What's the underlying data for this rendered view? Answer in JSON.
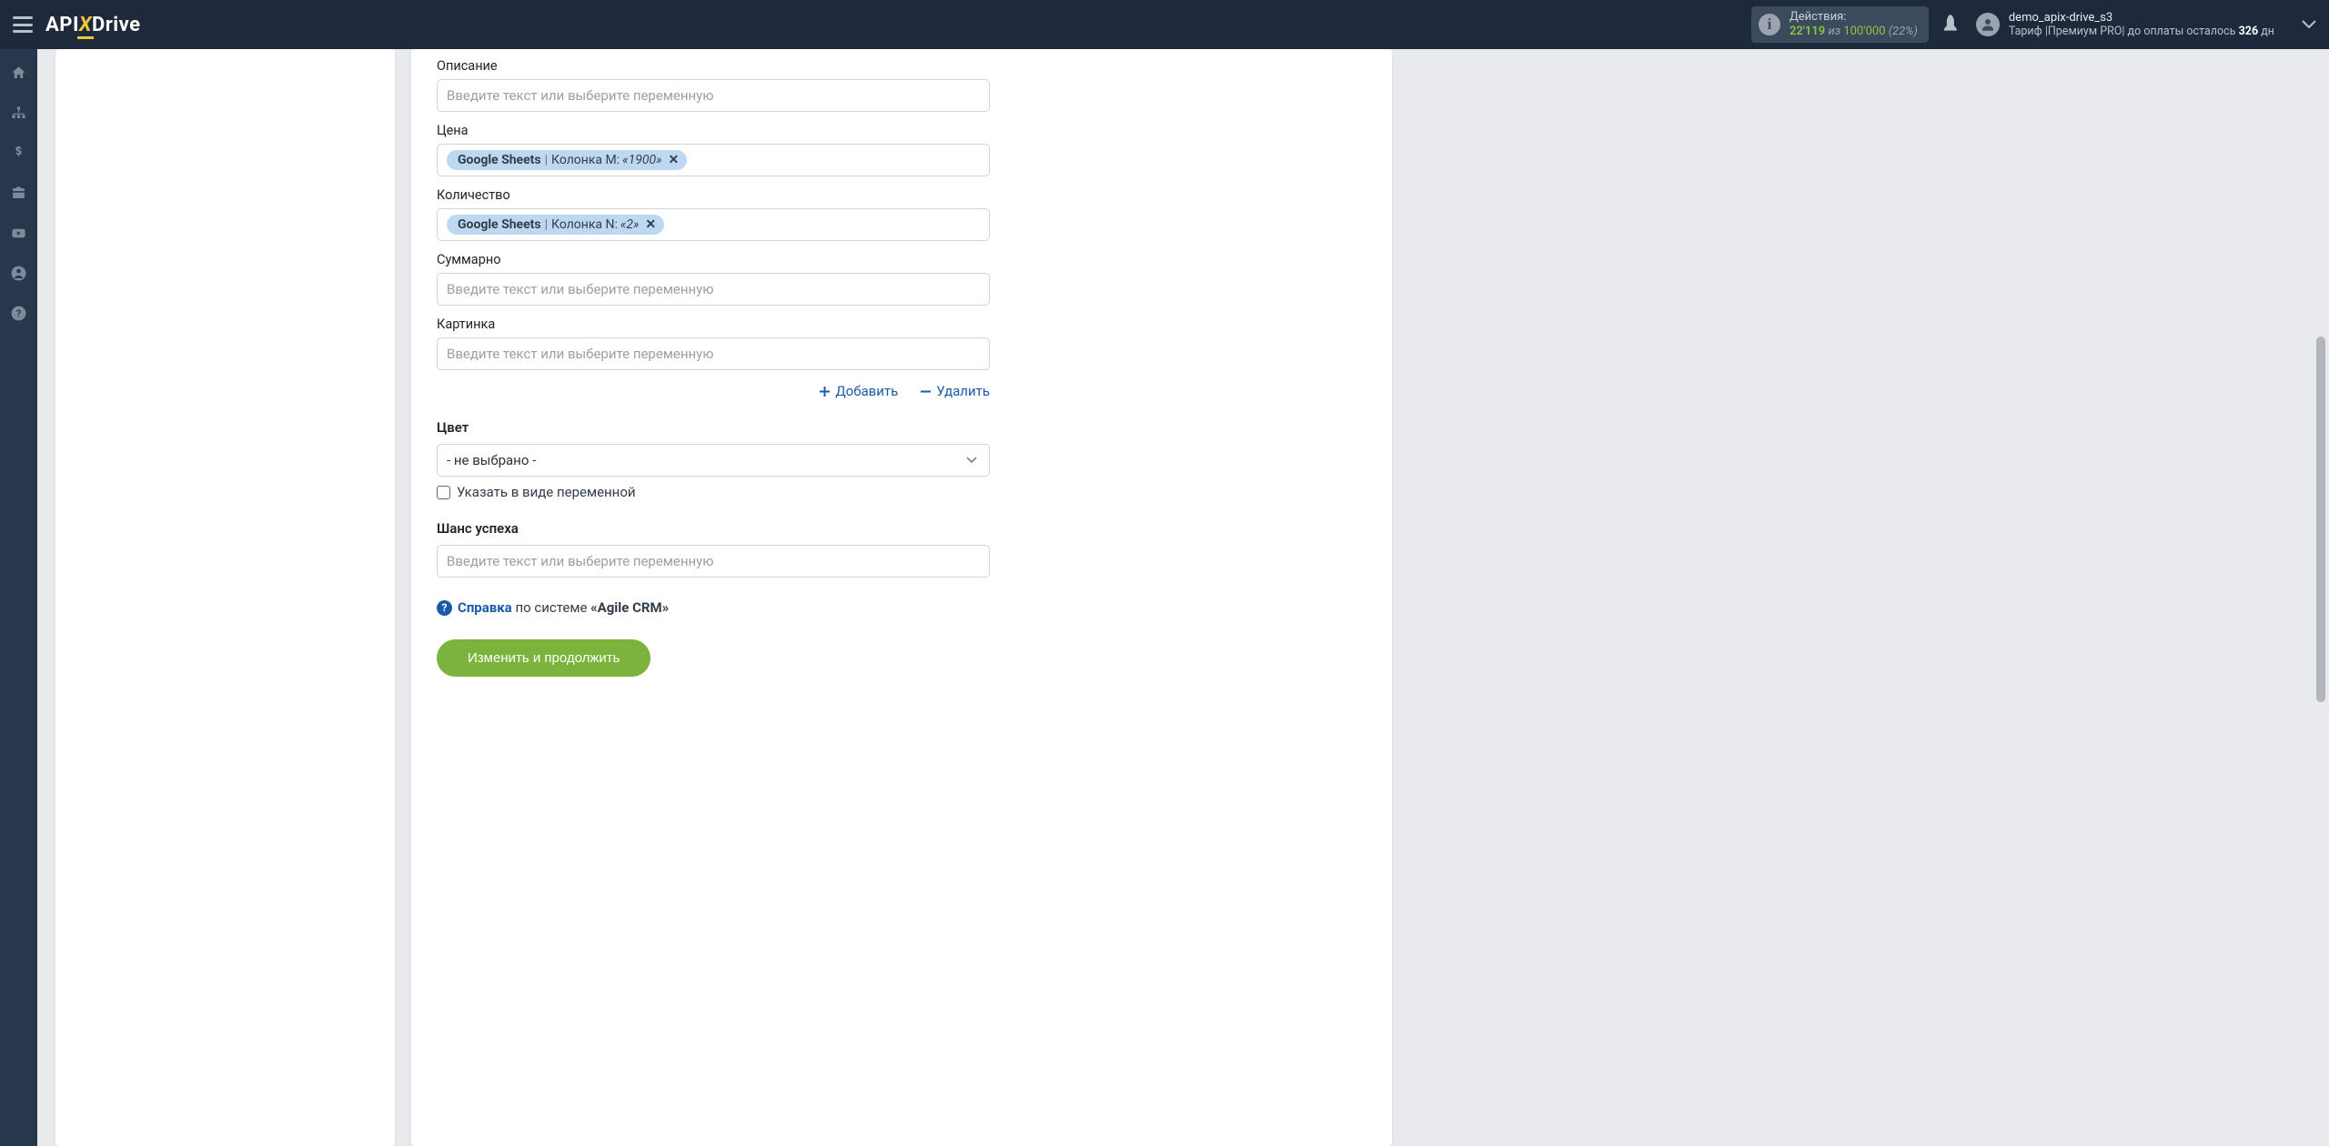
{
  "header": {
    "actions_label": "Действия:",
    "actions_current": "22'119",
    "actions_sep": "из",
    "actions_max": "100'000",
    "actions_pct": "(22%)",
    "user_name": "demo_apix-drive_s3",
    "plan_prefix": "Тариф |",
    "plan_name": "Премиум PRO",
    "plan_suffix": "| до оплаты осталось",
    "days_left": "326",
    "days_unit": "дн"
  },
  "form": {
    "description": {
      "label": "Описание",
      "placeholder": "Введите текст или выберите переменную"
    },
    "price": {
      "label": "Цена",
      "chip_source": "Google Sheets",
      "chip_col": "Колонка M:",
      "chip_val": "«1900»"
    },
    "quantity": {
      "label": "Количество",
      "chip_source": "Google Sheets",
      "chip_col": "Колонка N:",
      "chip_val": "«2»"
    },
    "total": {
      "label": "Суммарно",
      "placeholder": "Введите текст или выберите переменную"
    },
    "image": {
      "label": "Картинка",
      "placeholder": "Введите текст или выберите переменную"
    },
    "add": "Добавить",
    "delete": "Удалить",
    "color": {
      "label": "Цвет",
      "value": "- не выбрано -",
      "checkbox": "Указать в виде переменной"
    },
    "chance": {
      "label": "Шанс успеха",
      "placeholder": "Введите текст или выберите переменную"
    },
    "help_word": "Справка",
    "help_mid": "по системе",
    "help_system": "«Agile CRM»",
    "submit": "Изменить и продолжить"
  }
}
